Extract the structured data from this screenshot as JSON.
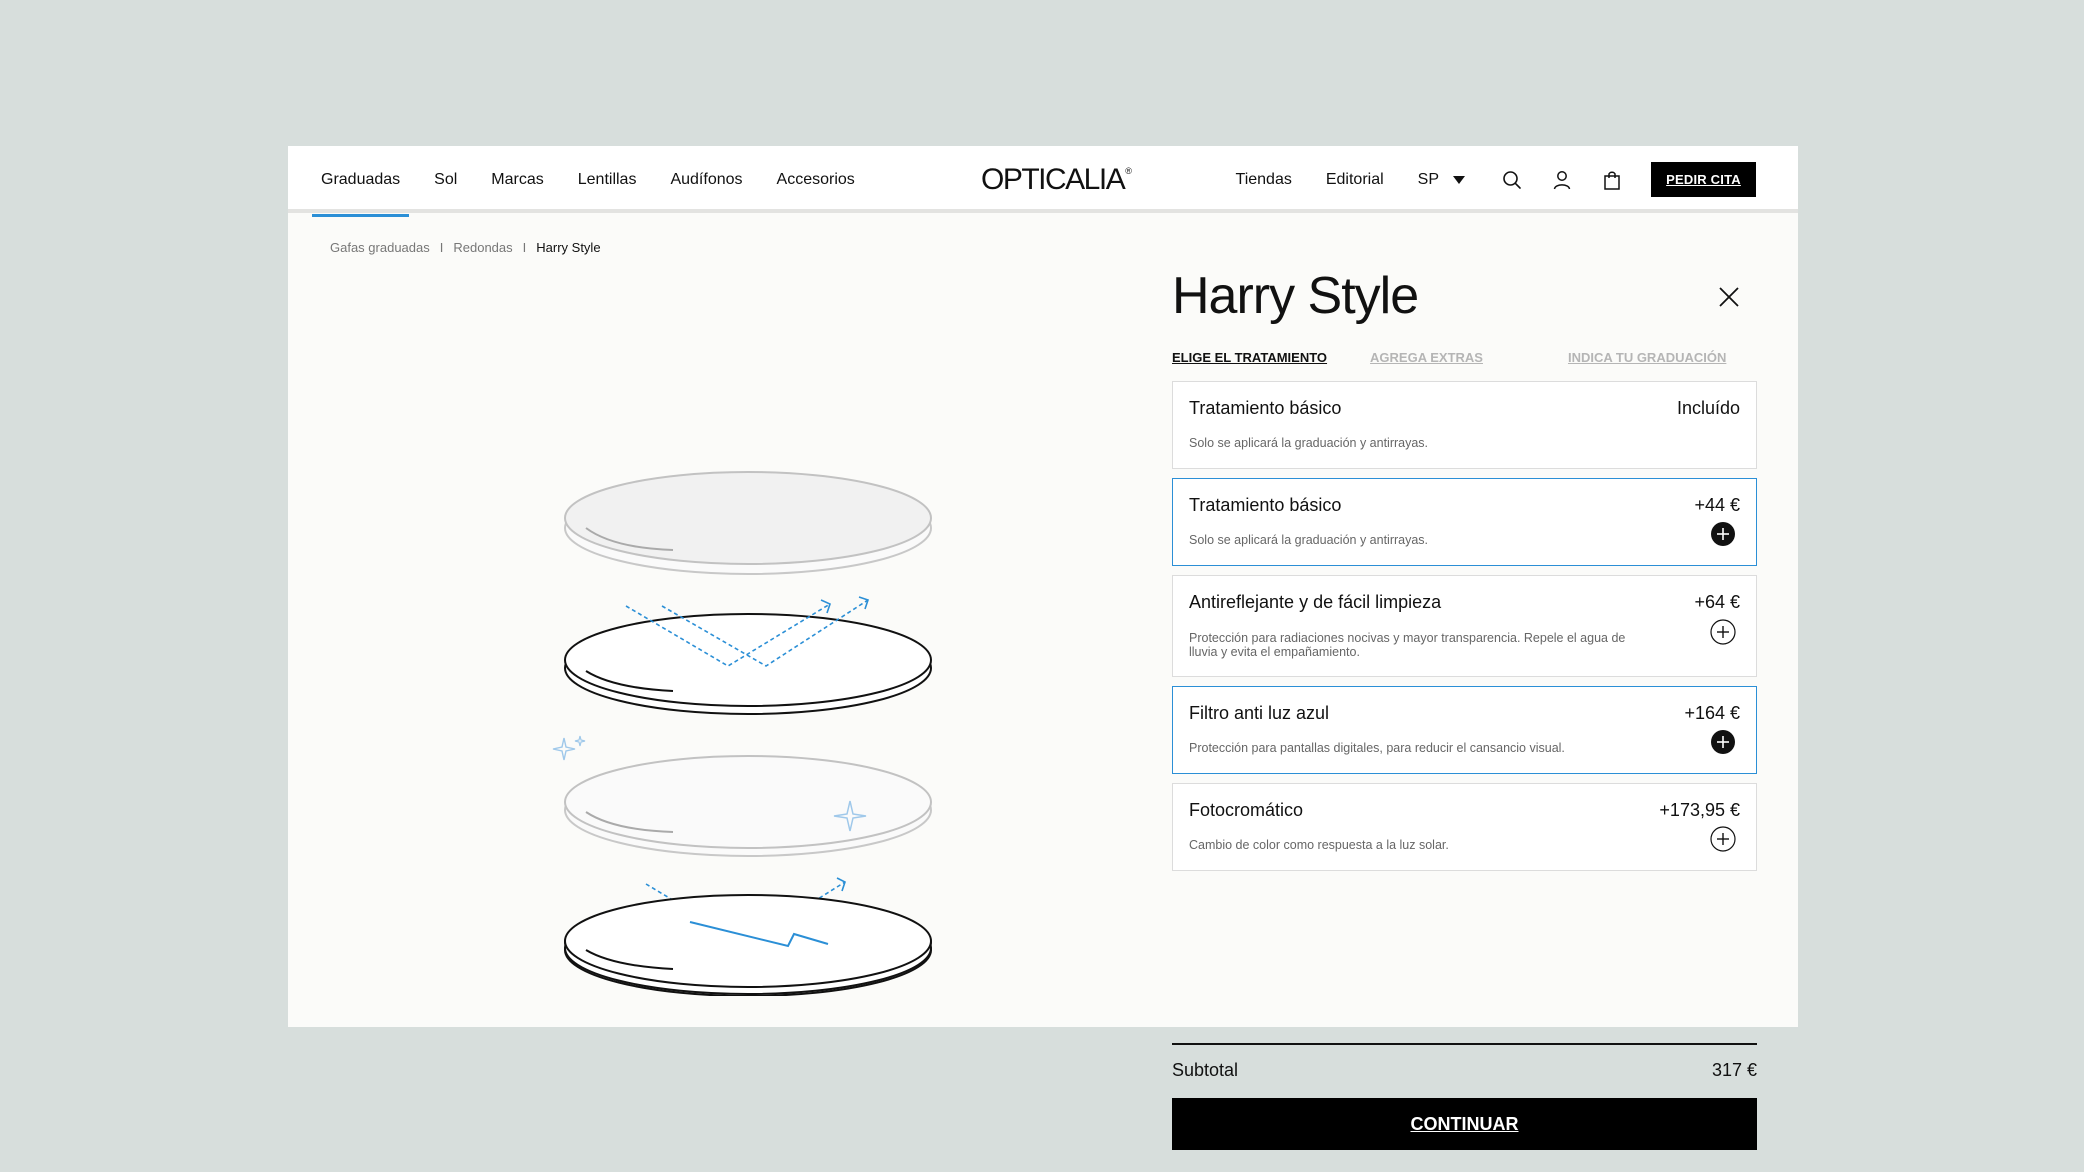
{
  "nav": {
    "left": [
      "Graduadas",
      "Sol",
      "Marcas",
      "Lentillas",
      "Audífonos",
      "Accesorios"
    ],
    "active_index": 0,
    "logo": "OPTICALIA",
    "logo_mark": "®",
    "right": [
      "Tiendas",
      "Editorial"
    ],
    "lang": "SP",
    "cta": "PEDIR CITA",
    "accent": "#2b8fd6"
  },
  "breadcrumb": [
    "Gafas graduadas",
    "Redondas",
    "Harry Style"
  ],
  "breadcrumb_sep": "I",
  "product": {
    "title": "Harry Style"
  },
  "steps": [
    "ELIGE EL TRATAMIENTO",
    "AGREGA EXTRAS",
    "INDICA TU GRADUACIÓN"
  ],
  "active_step": 0,
  "options": [
    {
      "title": "Tratamiento básico",
      "price": "Incluído",
      "desc": "Solo se aplicará la graduación y antirrayas.",
      "selected": false,
      "toggle": "none"
    },
    {
      "title": "Tratamiento básico",
      "price": "+44 €",
      "desc": "Solo se aplicará la graduación y antirrayas.",
      "selected": true,
      "toggle": "filled"
    },
    {
      "title": "Antireflejante y de fácil limpieza",
      "price": "+64 €",
      "desc": "Protección para radiaciones nocivas y mayor transparencia. Repele el agua de lluvia y evita el empañamiento.",
      "selected": false,
      "toggle": "outline"
    },
    {
      "title": "Filtro anti luz azul",
      "price": "+164 €",
      "desc": "Protección para pantallas digitales, para reducir el cansancio visual.",
      "selected": true,
      "toggle": "filled"
    },
    {
      "title": "Fotocromático",
      "price": "+173,95 €",
      "desc": "Cambio de color como respuesta a la luz solar.",
      "selected": false,
      "toggle": "outline"
    }
  ],
  "subtotal": {
    "label": "Subtotal",
    "value": "317 €"
  },
  "continue_label": "CONTINUAR"
}
